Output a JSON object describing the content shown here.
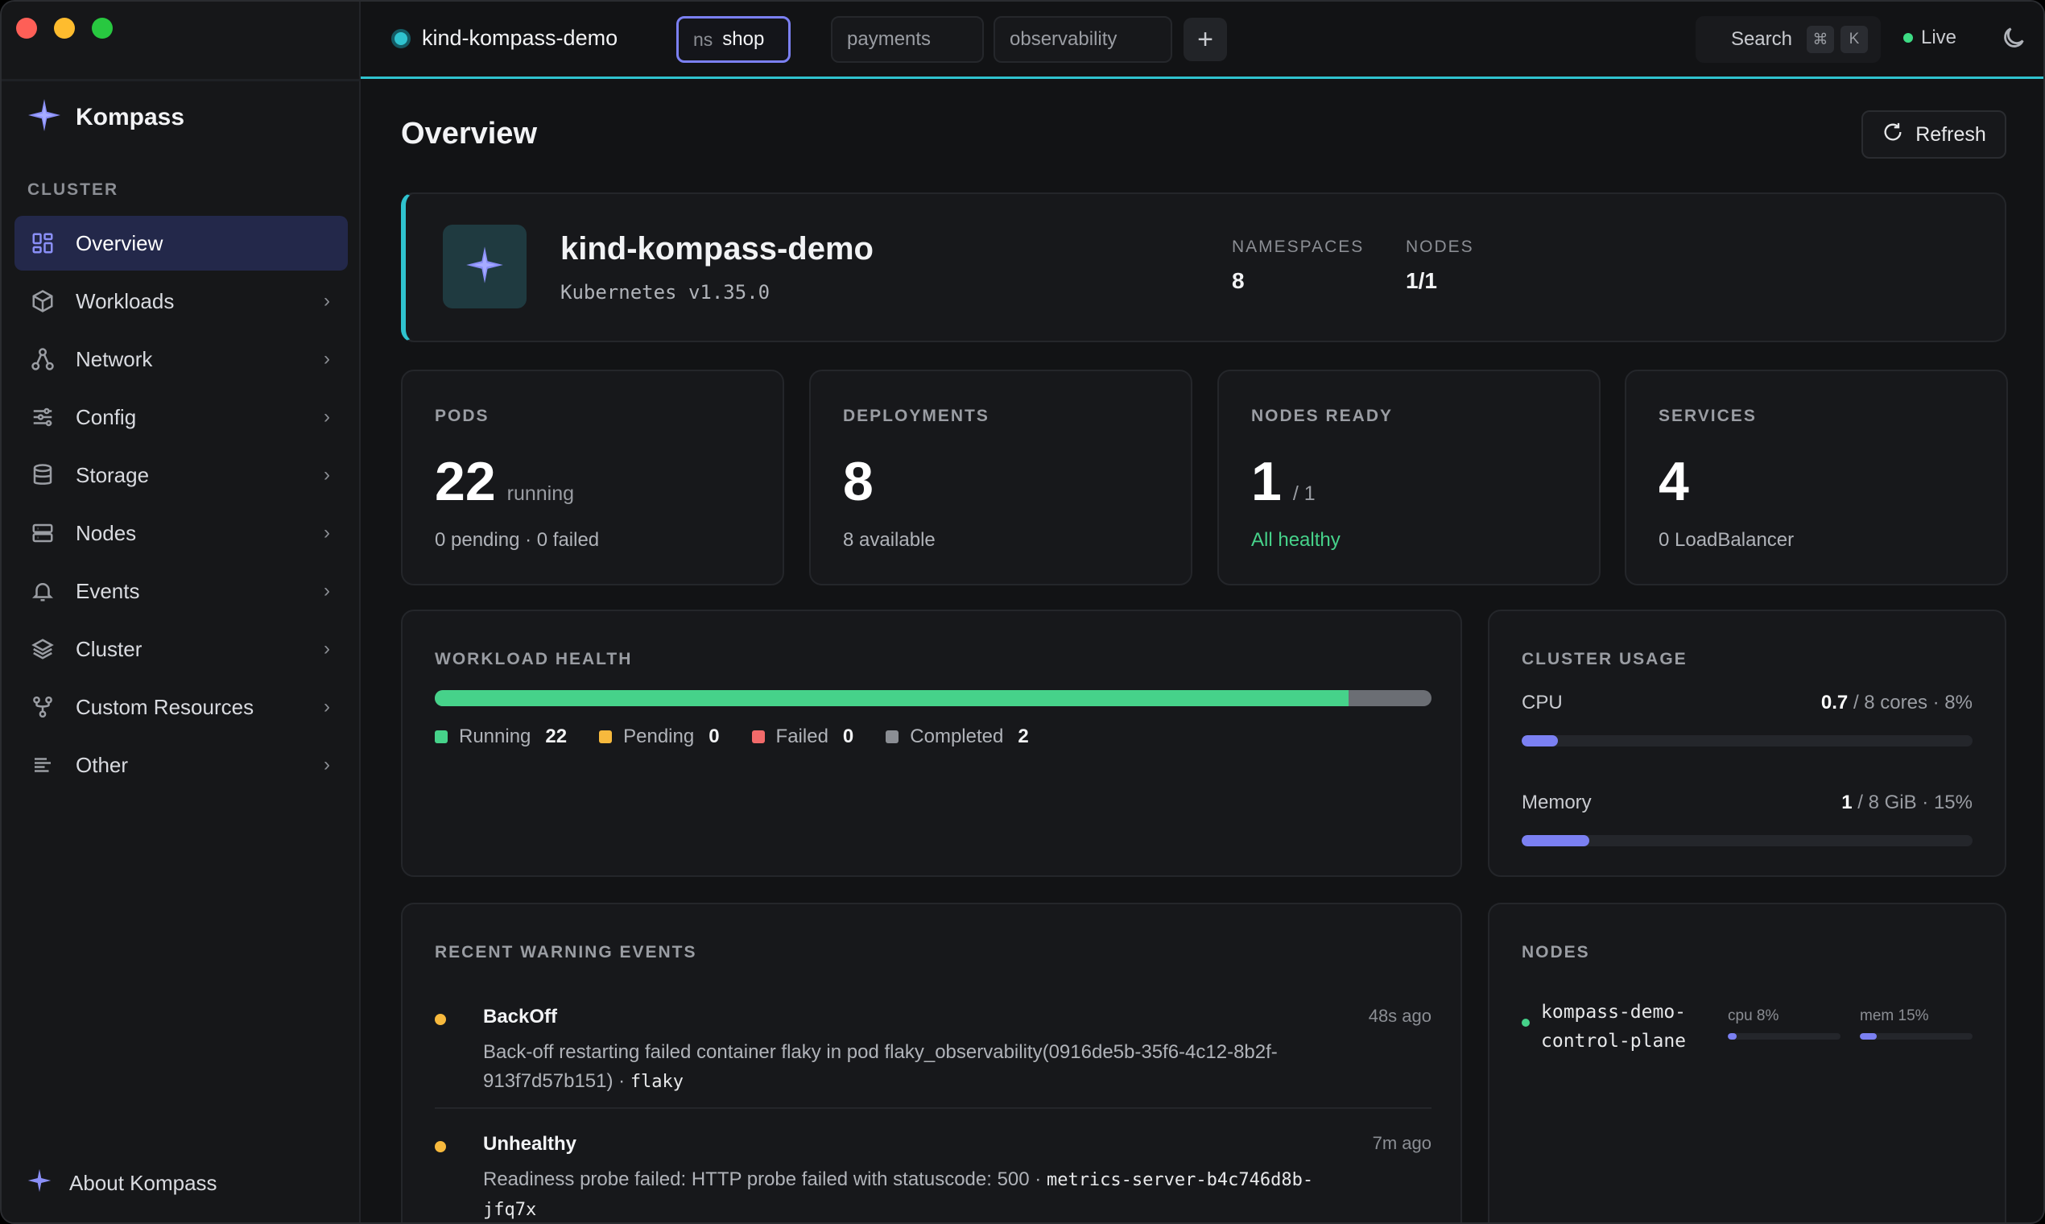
{
  "colors": {
    "accent": "#7b80f2",
    "cluster": "#2fc3cf",
    "running": "#46d28a",
    "pending": "#f7b93d",
    "failed": "#f26a6a",
    "completed": "#8b8e94"
  },
  "topbar": {
    "cluster_name": "kind-kompass-demo",
    "namespace_tabs": [
      {
        "prefix": "ns",
        "label": "shop",
        "active": true
      },
      {
        "label": "payments",
        "active": false
      },
      {
        "label": "observability",
        "active": false
      }
    ],
    "add_tab_icon": "plus-icon",
    "search_label": "Search",
    "search_keys": [
      "⌘",
      "K"
    ],
    "live_label": "Live",
    "theme_icon": "moon-icon"
  },
  "sidebar": {
    "brand": "Kompass",
    "section": "CLUSTER",
    "items": [
      {
        "label": "Overview",
        "icon": "grid-icon",
        "active": true
      },
      {
        "label": "Workloads",
        "icon": "cube-icon"
      },
      {
        "label": "Network",
        "icon": "network-icon"
      },
      {
        "label": "Config",
        "icon": "sliders-icon"
      },
      {
        "label": "Storage",
        "icon": "database-icon"
      },
      {
        "label": "Nodes",
        "icon": "server-icon"
      },
      {
        "label": "Events",
        "icon": "bell-icon"
      },
      {
        "label": "Cluster",
        "icon": "layers-icon"
      },
      {
        "label": "Custom Resources",
        "icon": "git-fork-icon"
      },
      {
        "label": "Other",
        "icon": "list-icon"
      }
    ],
    "about": "About Kompass"
  },
  "main": {
    "title": "Overview",
    "refresh": "Refresh",
    "hero": {
      "name": "kind-kompass-demo",
      "version": "Kubernetes v1.35.0",
      "namespaces_label": "NAMESPACES",
      "namespaces": "8",
      "nodes_label": "NODES",
      "nodes": "1/1"
    },
    "stats": [
      {
        "label": "PODS",
        "value": "22",
        "unit": "running",
        "sub": "0 pending · 0 failed"
      },
      {
        "label": "DEPLOYMENTS",
        "value": "8",
        "unit": "",
        "sub": "8 available"
      },
      {
        "label": "NODES READY",
        "value": "1",
        "unit": "/ 1",
        "sub": "All healthy"
      },
      {
        "label": "SERVICES",
        "value": "4",
        "unit": "",
        "sub": "0 LoadBalancer"
      }
    ],
    "workload_health": {
      "title": "WORKLOAD HEALTH",
      "running_fraction": 0.917,
      "legend": [
        {
          "label": "Running",
          "count": "22"
        },
        {
          "label": "Pending",
          "count": "0"
        },
        {
          "label": "Failed",
          "count": "0"
        },
        {
          "label": "Completed",
          "count": "2"
        }
      ]
    },
    "usage": {
      "title": "CLUSTER USAGE",
      "cpu": {
        "label": "CPU",
        "value": "0.7",
        "rest": "/ 8 cores · 8%",
        "fraction": 0.08
      },
      "memory": {
        "label": "Memory",
        "value": "1",
        "rest": "/ 8 GiB · 15%",
        "fraction": 0.15
      }
    },
    "events": {
      "title": "RECENT WARNING EVENTS",
      "items": [
        {
          "reason": "BackOff",
          "time": "48s ago",
          "message": "Back-off restarting failed container flaky in pod flaky_observability(0916de5b-35f6-4c12-8b2f-913f7d57b151) · ",
          "object": "flaky"
        },
        {
          "reason": "Unhealthy",
          "time": "7m ago",
          "message": "Readiness probe failed: HTTP probe failed with statuscode: 500 · ",
          "object": "metrics-server-b4c746d8b-jfq7x"
        }
      ]
    },
    "nodes": {
      "title": "NODES",
      "items": [
        {
          "name": "kompass-demo-control-plane",
          "cpu_label": "cpu 8%",
          "cpu_fraction": 0.08,
          "mem_label": "mem 15%",
          "mem_fraction": 0.15
        }
      ]
    }
  }
}
